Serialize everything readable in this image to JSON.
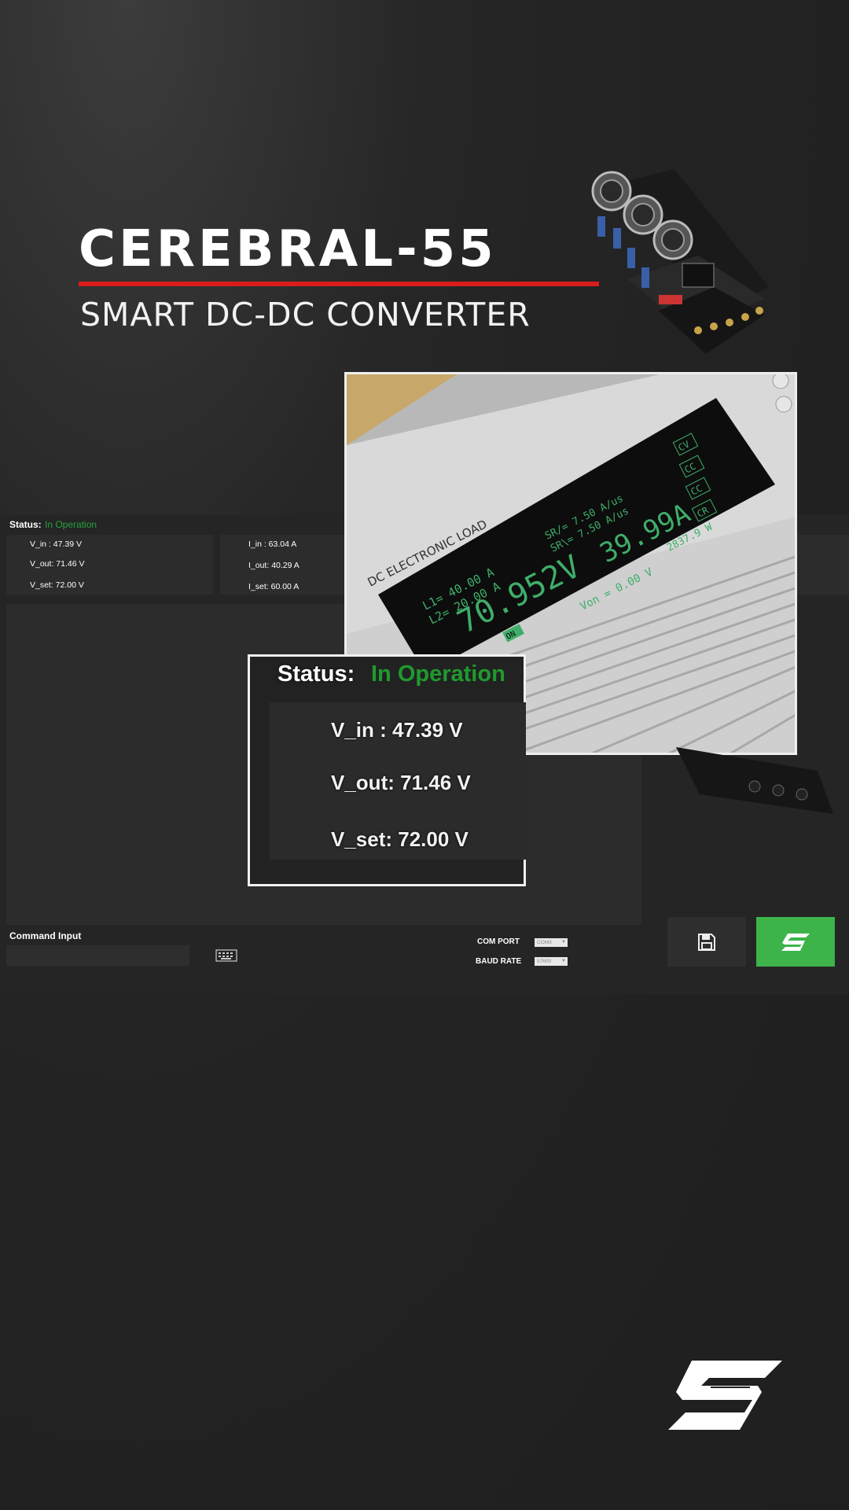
{
  "header": {
    "title": "CEREBRAL-55",
    "subtitle": "SMART DC-DC CONVERTER",
    "accent_color": "#d91c1c"
  },
  "photo": {
    "device_label": "DC ELECTRONIC LOAD",
    "voltage_reading": "70.952V",
    "current_reading": "39.99A",
    "power_reading": "2837.9 W",
    "l1": "L1= 40.00  A",
    "l2": "L2= 20.00  A",
    "sr_up": "SR/= 7.50  A/us",
    "sr_down": "SR\\= 7.50  A/us",
    "von": "Von = 0.00  V",
    "modes": [
      "CV",
      "CC",
      "CC",
      "CR"
    ],
    "on_badge": "ON"
  },
  "app": {
    "status_label": "Status:",
    "status_value": "In Operation",
    "status_color": "#22a33a",
    "voltages": {
      "v_in": "V_in : 47.39 V",
      "v_out": "V_out: 71.46 V",
      "v_set": "V_set: 72.00 V"
    },
    "currents": {
      "i_in": "I_in : 63.04 A",
      "i_out": "I_out: 40.29 A",
      "i_set": "I_set: 60.00 A"
    },
    "command_input_label": "Command Input",
    "command_input_value": "",
    "com_port_label": "COM PORT",
    "com_port_value": "COM3",
    "baud_rate_label": "BAUD RATE",
    "baud_rate_value": "57600",
    "save_icon": "floppy-disk-icon",
    "connect_icon": "brand-s-icon",
    "keyboard_icon": "keyboard-icon"
  },
  "zoom": {
    "status_label": "Status:",
    "status_value": "In Operation",
    "v_in": "V_in : 47.39 V",
    "v_out": "V_out: 71.46 V",
    "v_set": "V_set: 72.00 V"
  }
}
